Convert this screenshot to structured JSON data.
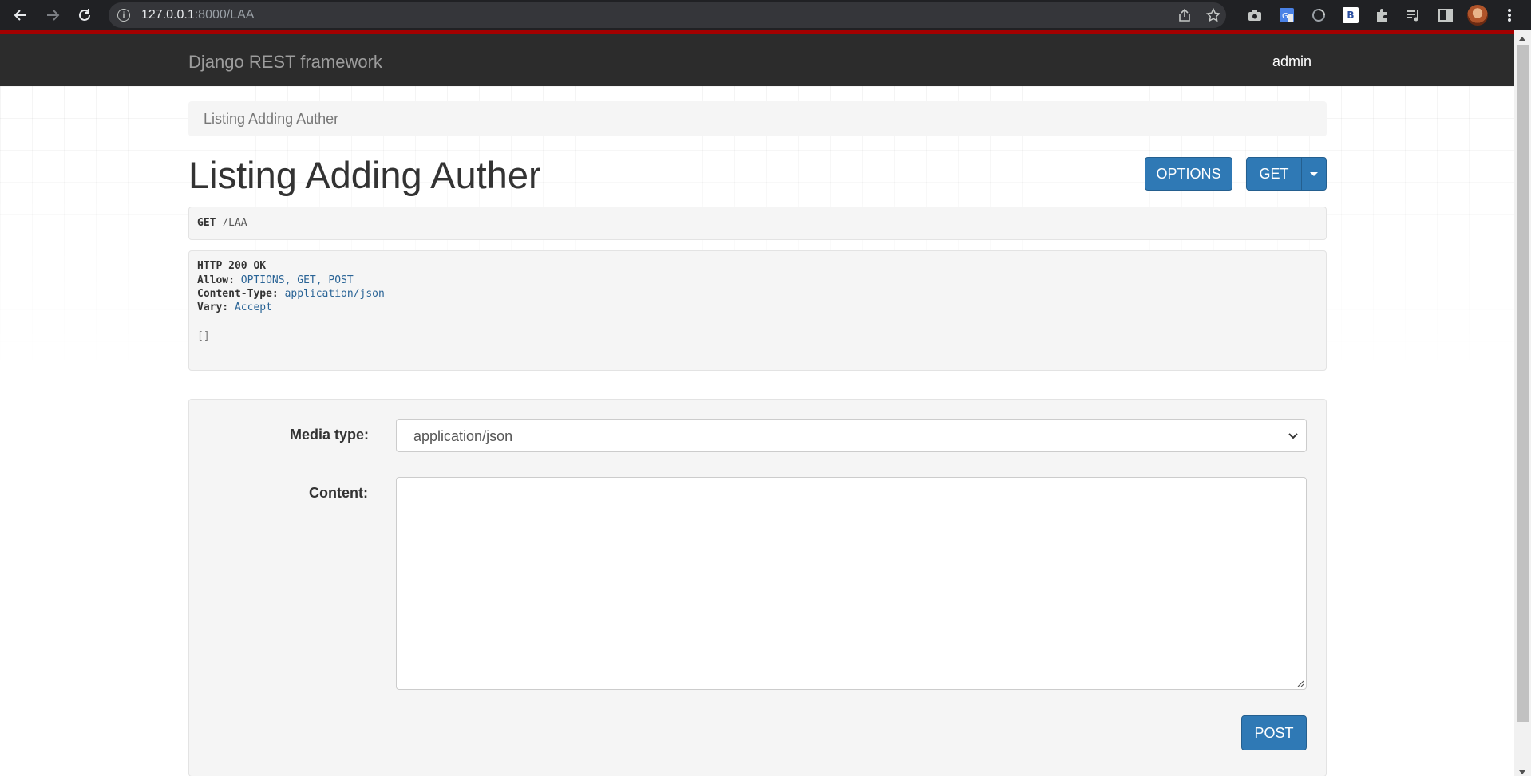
{
  "browser": {
    "url_host": "127.0.0.1",
    "url_path": ":8000/LAA",
    "extension_letter": "B"
  },
  "navbar": {
    "brand": "Django REST framework",
    "user": "admin"
  },
  "breadcrumb": {
    "label": "Listing Adding Auther"
  },
  "page": {
    "title": "Listing Adding Auther"
  },
  "actions": {
    "options_label": "OPTIONS",
    "get_label": "GET"
  },
  "request": {
    "method": "GET",
    "path": "/LAA"
  },
  "response": {
    "status": "HTTP 200 OK",
    "headers": [
      {
        "key": "Allow:",
        "value": "OPTIONS, GET, POST"
      },
      {
        "key": "Content-Type:",
        "value": "application/json"
      },
      {
        "key": "Vary:",
        "value": "Accept"
      }
    ],
    "body": "[]"
  },
  "form": {
    "media_type_label": "Media type:",
    "media_type_value": "application/json",
    "content_label": "Content:",
    "content_value": "",
    "submit_label": "POST"
  },
  "colors": {
    "navbar_bg": "#2c2c2c",
    "navbar_accent": "#a30000",
    "button_primary": "#2f79b5",
    "header_value": "#2a6496"
  }
}
